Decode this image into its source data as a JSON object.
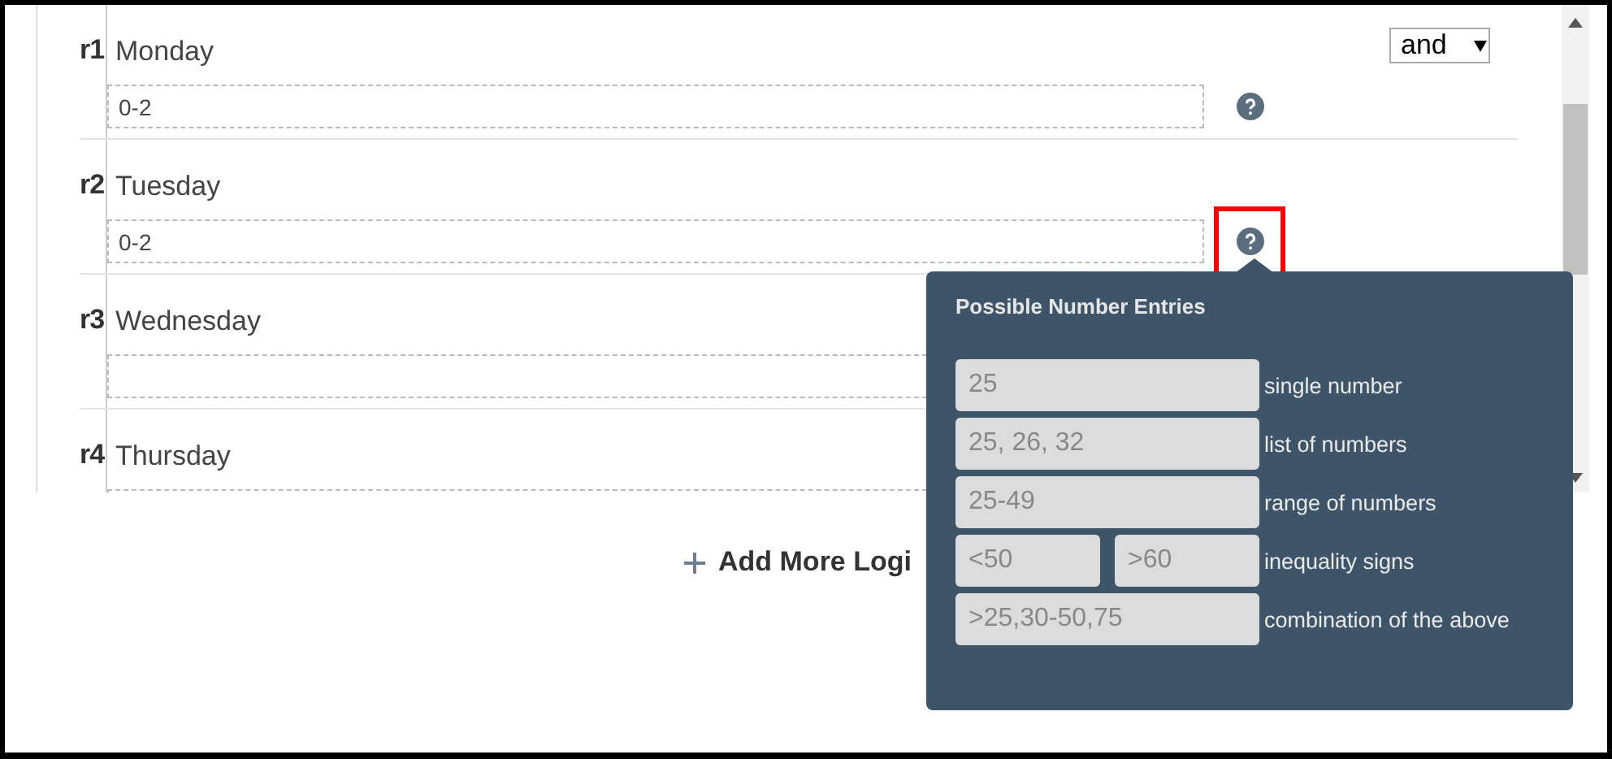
{
  "rows": [
    {
      "label": "r1",
      "name": "Monday",
      "value": "0-2",
      "help": {
        "selected": false
      },
      "conjunction": "and"
    },
    {
      "label": "r2",
      "name": "Tuesday",
      "value": "0-2",
      "help": {
        "selected": true
      }
    },
    {
      "label": "r3",
      "name": "Wednesday"
    },
    {
      "label": "r4",
      "name": "Thursday"
    }
  ],
  "add_button": {
    "label": "Add More Logi"
  },
  "popup": {
    "title": "Possible Number Entries",
    "entries": [
      {
        "values": [
          "25"
        ],
        "label": "single number"
      },
      {
        "values": [
          "25, 26, 32"
        ],
        "label": "list of numbers"
      },
      {
        "values": [
          "25-49"
        ],
        "label": "range of numbers"
      },
      {
        "values": [
          "<50",
          ">60"
        ],
        "label": "inequality signs"
      },
      {
        "values": [
          ">25,30-50,75"
        ],
        "label": "combination of the above"
      }
    ]
  }
}
